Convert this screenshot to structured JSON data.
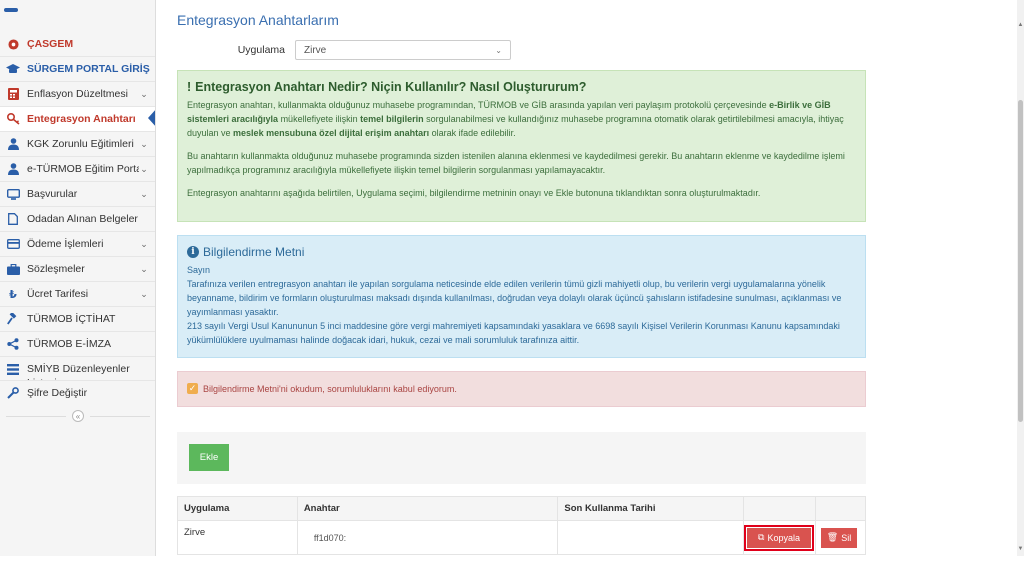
{
  "sidebar": {
    "top_partial": "",
    "items": [
      {
        "label": "ÇASGEM",
        "icon": "circle-dot-icon",
        "chevron": false
      },
      {
        "label": "SÜRGEM PORTAL GİRİŞ",
        "icon": "graduation-cap-icon",
        "chevron": false
      },
      {
        "label": "Enflasyon Düzeltmesi",
        "icon": "calculator-icon",
        "chevron": true
      },
      {
        "label": "Entegrasyon Anahtarı",
        "icon": "key-icon",
        "chevron": false
      },
      {
        "label": "KGK Zorunlu Eğitimleri",
        "icon": "user-icon",
        "chevron": true
      },
      {
        "label": "e-TÜRMOB Eğitim Portalı",
        "icon": "user-icon",
        "chevron": true
      },
      {
        "label": "Başvurular",
        "icon": "monitor-icon",
        "chevron": true
      },
      {
        "label": "Odadan Alınan Belgeler",
        "icon": "file-icon",
        "chevron": false
      },
      {
        "label": "Ödeme İşlemleri",
        "icon": "credit-card-icon",
        "chevron": true
      },
      {
        "label": "Sözleşmeler",
        "icon": "briefcase-icon",
        "chevron": true
      },
      {
        "label": "Ücret Tarifesi",
        "icon": "money-icon",
        "chevron": true
      },
      {
        "label": "TÜRMOB İÇTİHAT",
        "icon": "gavel-icon",
        "chevron": false
      },
      {
        "label": "TÜRMOB E-İMZA",
        "icon": "share-icon",
        "chevron": false
      },
      {
        "label": "SMİYB Düzenleyenler Listesi",
        "icon": "list-icon",
        "chevron": false
      },
      {
        "label": "Şifre Değiştir",
        "icon": "wrench-icon",
        "chevron": false
      }
    ],
    "collapse_glyph": "«"
  },
  "page": {
    "title": "Entegrasyon Anahtarlarım",
    "app_label": "Uygulama",
    "app_value": "Zirve"
  },
  "green_box": {
    "heading": "Entegrasyon Anahtarı Nedir? Niçin Kullanılır? Nasıl Oluştururum?",
    "p1_a": "Entegrasyon anahtarı, kullanmakta olduğunuz muhasebe programından, TÜRMOB ve GİB arasında yapılan veri paylaşım protokolü çerçevesinde ",
    "p1_b": "e-Birlik ve GİB sistemleri aracılığıyla",
    "p1_c": " mükellefiyete ilişkin ",
    "p1_d": "temel bilgilerin",
    "p1_e": " sorgulanabilmesi ve kullandığınız muhasebe programına otomatik olarak getirtilebilmesi amacıyla, ihtiyaç duyulan ve ",
    "p1_f": "meslek mensubuna özel dijital erişim anahtarı",
    "p1_g": " olarak ifade edilebilir.",
    "p2": "Bu anahtarın kullanmakta olduğunuz muhasebe programında sizden istenilen alanına eklenmesi ve kaydedilmesi gerekir. Bu anahtarın eklenme ve kaydedilme işlemi yapılmadıkça programınız aracılığıyla mükellefiyete ilişkin temel bilgilerin sorgulanması yapılamayacaktır.",
    "p3": "Entegrasyon anahtarını aşağıda belirtilen, Uygulama seçimi, bilgilendirme metninin onayı ve Ekle butonuna tıklandıktan sonra oluşturulmaktadır."
  },
  "blue_box": {
    "heading": "Bilgilendirme Metni",
    "p1": "Sayın",
    "p2": "Tarafınıza verilen entregrasyon anahtarı ile yapılan sorgulama neticesinde elde edilen verilerin tümü gizli mahiyetli olup, bu verilerin vergi uygulamalarına yönelik beyanname, bildirim ve formların oluşturulması maksadı dışında kullanılması, doğrudan veya dolaylı olarak üçüncü şahısların istifadesine sunulması, açıklanması ve yayımlanması yasaktır.",
    "p3": "213 sayılı Vergi Usul Kanununun 5 inci maddesine göre vergi mahremiyeti kapsamındaki yasaklara ve 6698 sayılı Kişisel Verilerin Korunması Kanunu kapsamındaki yükümlülüklere uyulmaması halinde doğacak idari, hukuk, cezai ve mali sorumluluk tarafınıza aittir."
  },
  "consent": {
    "text": "Bilgilendirme Metni'ni okudum, sorumluluklarını kabul ediyorum.",
    "checked": true
  },
  "actions": {
    "add_label": "Ekle"
  },
  "table": {
    "headers": [
      "Uygulama",
      "Anahtar",
      "Son Kullanma Tarihi",
      "",
      ""
    ],
    "rows": [
      {
        "app": "Zirve",
        "key": "ff1d070:",
        "expiry": "",
        "copy_label": "Kopyala",
        "delete_label": "Sil"
      }
    ]
  },
  "colors": {
    "accent_blue": "#2a5ea8",
    "success_green": "#5cb85c",
    "danger_red": "#d9534f",
    "highlight_outline": "#e0001a"
  }
}
